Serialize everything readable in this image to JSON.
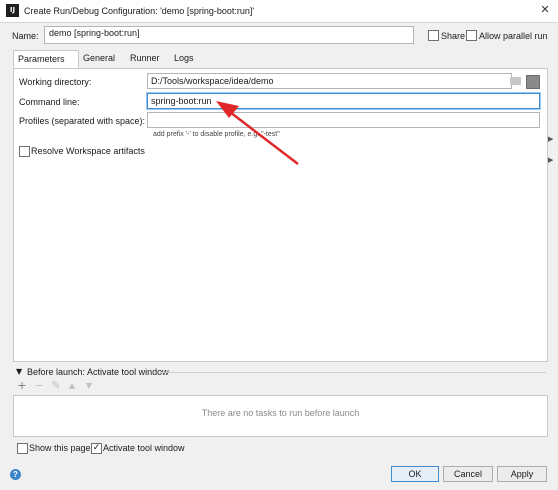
{
  "window": {
    "title": "Create Run/Debug Configuration: 'demo [spring-boot:run]'",
    "app_icon": "IJ"
  },
  "name": {
    "label": "Name:",
    "value": "demo [spring-boot:run]"
  },
  "options": {
    "share_label": "Share",
    "share_checked": false,
    "parallel_label": "Allow parallel run",
    "parallel_checked": false
  },
  "tabs": [
    {
      "label": "Parameters",
      "active": true
    },
    {
      "label": "General",
      "active": false
    },
    {
      "label": "Runner",
      "active": false
    },
    {
      "label": "Logs",
      "active": false
    }
  ],
  "parameters": {
    "working_directory_label": "Working directory:",
    "working_directory_value": "D:/Tools/workspace/idea/demo",
    "command_line_label": "Command line:",
    "command_line_value": "spring-boot:run",
    "profiles_label": "Profiles (separated with space):",
    "profiles_value": "",
    "profiles_hint": "add prefix '-' to disable profile, e.g. \"-test\"",
    "resolve_label": "Resolve Workspace artifacts",
    "resolve_checked": false
  },
  "before_launch": {
    "title": "Before launch: Activate tool window",
    "empty_text": "There are no tasks to run before launch",
    "toolbar_icons": [
      "add-icon",
      "remove-icon",
      "edit-icon",
      "move-up-icon",
      "move-down-icon"
    ]
  },
  "footer": {
    "show_page_label": "Show this page",
    "show_page_checked": false,
    "activate_label": "Activate tool window",
    "activate_checked": true,
    "ok_label": "OK",
    "cancel_label": "Cancel",
    "apply_label": "Apply",
    "help_glyph": "?"
  },
  "colors": {
    "accent": "#3d8fd1",
    "annotation_arrow": "#e0282a"
  }
}
